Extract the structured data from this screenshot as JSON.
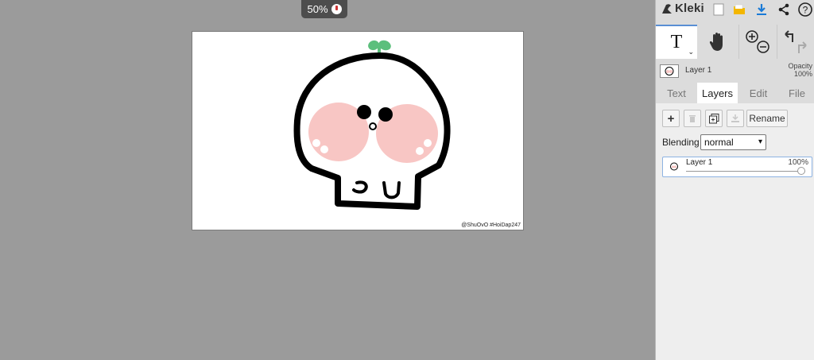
{
  "app": {
    "name": "Kleki"
  },
  "canvas": {
    "zoom_label": "50%",
    "watermark": "@ShuOvO #HoiDap247"
  },
  "toolbar": {
    "icons": [
      "new-image-icon",
      "open-folder-icon",
      "download-icon",
      "share-icon",
      "help-icon"
    ],
    "help_label": "?"
  },
  "tools": {
    "active": "text",
    "text_label": "T",
    "caret": "⌄"
  },
  "layer_header": {
    "name": "Layer 1",
    "opacity_title": "Opacity",
    "opacity_value": "100%"
  },
  "tabs": [
    {
      "label": "Text"
    },
    {
      "label": "Layers"
    },
    {
      "label": "Edit"
    },
    {
      "label": "File"
    }
  ],
  "active_tab": "Layers",
  "layers_panel": {
    "add_label": "+",
    "rename_label": "Rename",
    "blending_label": "Blending",
    "blending_value": "normal",
    "layers": [
      {
        "name": "Layer 1",
        "opacity": "100%",
        "opacity_fraction": 1.0
      }
    ]
  },
  "colors": {
    "accent": "#5a8fd4",
    "panel": "#dcdcdc",
    "workspace": "#9b9b9b",
    "sprout": "#5cbf7c",
    "cheek": "#f8c6c4"
  }
}
